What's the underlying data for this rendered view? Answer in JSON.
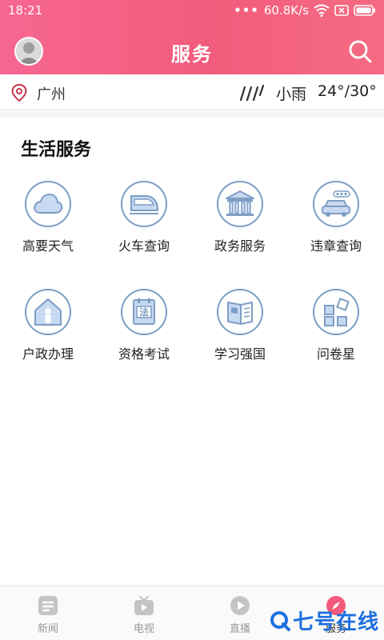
{
  "status_bar": {
    "time": "18:21",
    "network_speed": "60.8K/s"
  },
  "header": {
    "title": "服务"
  },
  "location_bar": {
    "city": "广州",
    "weather": "小雨",
    "temperature": "24°/30°"
  },
  "section": {
    "title": "生活服务"
  },
  "services": [
    {
      "label": "高要天气",
      "icon": "cloud-icon"
    },
    {
      "label": "火车查询",
      "icon": "train-icon"
    },
    {
      "label": "政务服务",
      "icon": "government-building-icon"
    },
    {
      "label": "违章查询",
      "icon": "car-icon"
    },
    {
      "label": "户政办理",
      "icon": "house-person-icon"
    },
    {
      "label": "资格考试",
      "icon": "law-book-icon"
    },
    {
      "label": "学习强国",
      "icon": "flag-book-icon"
    },
    {
      "label": "问卷星",
      "icon": "grid-squares-icon"
    }
  ],
  "bottom_nav": [
    {
      "label": "新闻",
      "icon": "news-icon",
      "active": false
    },
    {
      "label": "电视",
      "icon": "tv-icon",
      "active": false
    },
    {
      "label": "直播",
      "icon": "play-icon",
      "active": false
    },
    {
      "label": "服务",
      "icon": "compass-icon",
      "active": true
    }
  ],
  "watermark": {
    "text": "七号在线"
  },
  "colors": {
    "header_start": "#f76791",
    "header_end": "#f46b82",
    "icon_stroke": "#7d9ec4",
    "icon_fill": "#c8d9f2",
    "active_tab": "#f2597a",
    "location_pin": "#c8354a",
    "watermark": "#1e6fe0"
  }
}
